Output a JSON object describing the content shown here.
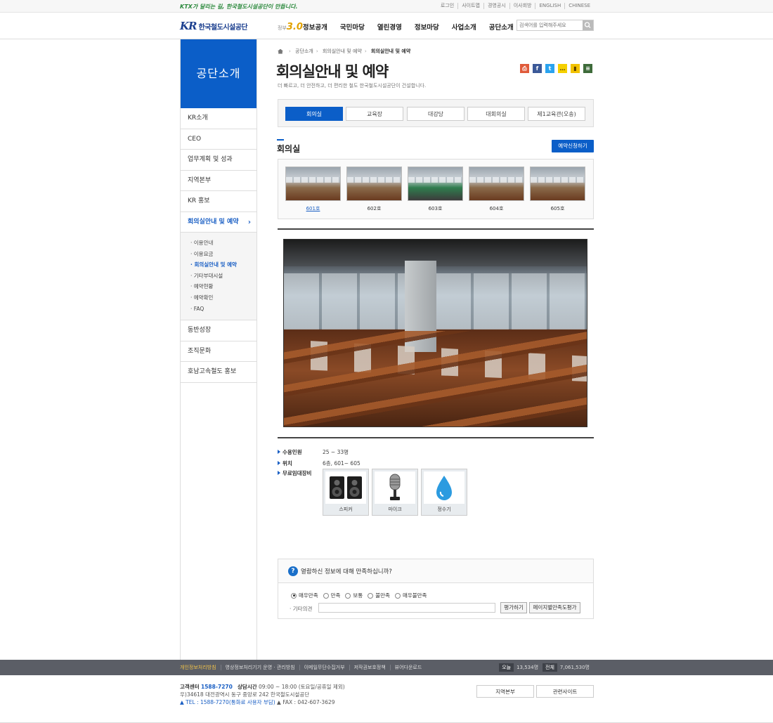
{
  "top": {
    "slogan": "KTX가 달리는 길, 한국철도시설공단이 만듭니다.",
    "util_links": [
      "로그인",
      "사이트맵",
      "경영공시",
      "이사회방",
      "ENGLISH",
      "CHINESE"
    ]
  },
  "header": {
    "logo_mark": "KR",
    "logo_text": "한국철도시설공단",
    "nav_prefix_small": "정부",
    "nav_prefix_num": "3.0",
    "nav": [
      "정보공개",
      "국민마당",
      "열린경영",
      "정보마당",
      "사업소개",
      "공단소개"
    ],
    "search_placeholder": "검색어를 입력해주세요"
  },
  "lnb": {
    "title": "공단소개",
    "items": [
      "KR소개",
      "CEO",
      "업무계획 및 성과",
      "지역본부",
      "KR 홍보",
      "회의실안내 및 예약"
    ],
    "active_arrow": "›",
    "sub": [
      "이용안내",
      "이용요금",
      "회의실안내 및 예약",
      "기타부대시설",
      "예약현황",
      "예약확인",
      "FAQ"
    ],
    "items_after": [
      "동반성장",
      "조직문화",
      "호남고속철도 홍보"
    ]
  },
  "breadcrumb": [
    "공단소개",
    "회의실안내 및 예약",
    "회의실안내 및 예약"
  ],
  "page": {
    "title": "회의실안내 및 예약",
    "desc": "더 빠르고, 더 안전하고, 더 편리한 철도 한국철도시설공단이 건설합니다."
  },
  "share_icons": [
    {
      "name": "print-icon",
      "color": "#e05a3a",
      "glyph": "⎙"
    },
    {
      "name": "facebook-icon",
      "color": "#3b5998",
      "glyph": "f"
    },
    {
      "name": "twitter-icon",
      "color": "#2aa3ef",
      "glyph": "t"
    },
    {
      "name": "kakaotalk-icon",
      "color": "#f5d000",
      "glyph": "…"
    },
    {
      "name": "kakaostory-icon",
      "color": "#f2c200",
      "glyph": "▮"
    },
    {
      "name": "band-icon",
      "color": "#3e6b3a",
      "glyph": "≡"
    }
  ],
  "tabs": [
    "회의실",
    "교육장",
    "대강당",
    "대회의실",
    "제1교육관(오송)"
  ],
  "section": {
    "title": "회의실",
    "reserve_button": "예약신청하기"
  },
  "rooms": [
    "601호",
    "602호",
    "603호",
    "604호",
    "605호"
  ],
  "info": {
    "capacity_label": "수용인원",
    "capacity_value": "25 ~ 33명",
    "location_label": "위치",
    "location_value": "6층, 601~ 605",
    "equipment_label": "무료임대장비"
  },
  "equipment": [
    "스피커",
    "마이크",
    "정수기"
  ],
  "survey": {
    "question": "열람하신 정보에 대해 만족하십니까?",
    "options": [
      "매우만족",
      "만족",
      "보통",
      "불만족",
      "매우불만족"
    ],
    "selected": "매우만족",
    "etc_label": "· 기타의견",
    "submit": "평가하기",
    "page_eval": "페이지별만족도평가"
  },
  "footer": {
    "links": [
      "개인정보처리방침",
      "영상정보처리기기 운영 · 관리방침",
      "이메일무단수집거부",
      "저작권보호정책",
      "뷰어다운로드"
    ],
    "today_label": "오늘",
    "today_value": "13,534명",
    "total_label": "전체",
    "total_value": "7,061,530명",
    "cs_label": "고객센터",
    "cs_phone": "1588-7270",
    "hours_label": "상담시간",
    "hours": "09:00 ~ 18:00 (토요일/공휴일 제외)",
    "address": "우)34618 대전광역시 동구 중앙로 242 한국철도시설공단",
    "tel": "▲ TEL : 1588-7270(통화료 사용자 부담)",
    "fax": "▲ FAX : 042-607-3629",
    "btn_region": "지역본부",
    "btn_related": "관련사이트"
  }
}
